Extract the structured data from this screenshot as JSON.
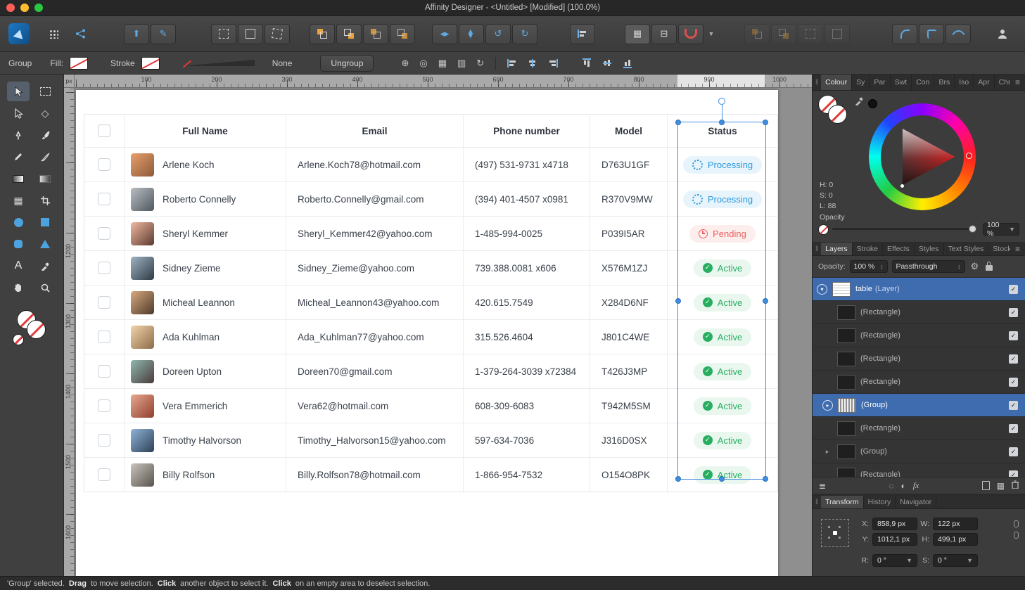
{
  "titlebar": {
    "title": "Affinity Designer - <Untitled> [Modified] (100.0%)"
  },
  "context_toolbar": {
    "selection_label": "Group",
    "fill_label": "Fill:",
    "stroke_label": "Stroke",
    "stroke_width_label": "None",
    "ungroup_button": "Ungroup"
  },
  "rulers": {
    "unit": "px",
    "horizontal_ticks": [
      100,
      200,
      300,
      400,
      500,
      600,
      700,
      800,
      900,
      1000
    ],
    "vertical_ticks": [
      1200,
      1300,
      1400,
      1500,
      1600
    ]
  },
  "document_table": {
    "columns": [
      "Full Name",
      "Email",
      "Phone number",
      "Model",
      "Status"
    ],
    "rows": [
      {
        "name": "Arlene Koch",
        "email": "Arlene.Koch78@hotmail.com",
        "phone": "(497) 531-9731 x4718",
        "model": "D763U1GF",
        "status": "Processing",
        "status_type": "processing",
        "avatar": [
          "#e9a06b",
          "#8a5a3b"
        ]
      },
      {
        "name": "Roberto Connelly",
        "email": "Roberto.Connelly@gmail.com",
        "phone": "(394) 401-4507 x0981",
        "model": "R370V9MW",
        "status": "Processing",
        "status_type": "processing",
        "avatar": [
          "#b9bec2",
          "#4f585f"
        ]
      },
      {
        "name": "Sheryl Kemmer",
        "email": "Sheryl_Kemmer42@yahoo.com",
        "phone": "1-485-994-0025",
        "model": "P039I5AR",
        "status": "Pending",
        "status_type": "pending",
        "avatar": [
          "#f2b8a0",
          "#5a3a30"
        ]
      },
      {
        "name": "Sidney Zieme",
        "email": "Sidney_Zieme@yahoo.com",
        "phone": "739.388.0081 x606",
        "model": "X576M1ZJ",
        "status": "Active",
        "status_type": "active",
        "avatar": [
          "#9fb4c4",
          "#2e3a44"
        ]
      },
      {
        "name": "Micheal Leannon",
        "email": "Micheal_Leannon43@yahoo.com",
        "phone": "420.615.7549",
        "model": "X284D6NF",
        "status": "Active",
        "status_type": "active",
        "avatar": [
          "#d9a97f",
          "#4e3a2a"
        ]
      },
      {
        "name": "Ada Kuhlman",
        "email": "Ada_Kuhlman77@yahoo.com",
        "phone": "315.526.4604",
        "model": "J801C4WE",
        "status": "Active",
        "status_type": "active",
        "avatar": [
          "#f0d4a8",
          "#8d6b4a"
        ]
      },
      {
        "name": "Doreen Upton",
        "email": "Doreen70@gmail.com",
        "phone": "1-379-264-3039 x72384",
        "model": "T426J3MP",
        "status": "Active",
        "status_type": "active",
        "avatar": [
          "#8fb8b0",
          "#4a3a3a"
        ]
      },
      {
        "name": "Vera Emmerich",
        "email": "Vera62@hotmail.com",
        "phone": "608-309-6083",
        "model": "T942M5SM",
        "status": "Active",
        "status_type": "active",
        "avatar": [
          "#e8a88e",
          "#8f3f2e"
        ]
      },
      {
        "name": "Timothy Halvorson",
        "email": "Timothy_Halvorson15@yahoo.com",
        "phone": "597-634-7036",
        "model": "J316D0SX",
        "status": "Active",
        "status_type": "active",
        "avatar": [
          "#8fb3d9",
          "#2e4055"
        ]
      },
      {
        "name": "Billy Rolfson",
        "email": "Billy.Rolfson78@hotmail.com",
        "phone": "1-866-954-7532",
        "model": "O154O8PK",
        "status": "Active",
        "status_type": "active",
        "avatar": [
          "#c9c4bd",
          "#57524b"
        ]
      }
    ],
    "status_colors": {
      "processing": {
        "fg": "#2e9bdb",
        "bg": "#e8f4fc"
      },
      "pending": {
        "fg": "#ec5f5f",
        "bg": "#fdeeee"
      },
      "active": {
        "fg": "#27ae60",
        "bg": "#e9f7ef"
      }
    }
  },
  "colour_panel": {
    "tabs": [
      "Colour",
      "Sy",
      "Par",
      "Swt",
      "Con",
      "Brs",
      "Iso",
      "Apr",
      "Chr"
    ],
    "active_tab": "Colour",
    "hsl": {
      "h_label": "H: 0",
      "s_label": "S: 0",
      "l_label": "L: 88"
    },
    "opacity_label": "Opacity",
    "opacity_value": "100 %"
  },
  "layers_panel": {
    "tabs": [
      "Layers",
      "Stroke",
      "Effects",
      "Styles",
      "Text Styles",
      "Stock"
    ],
    "active_tab": "Layers",
    "opacity_label": "Opacity:",
    "opacity_value": "100 %",
    "blend_mode": "Passthrough",
    "layers": [
      {
        "label": "table",
        "suffix": "(Layer)",
        "selected": true,
        "disclosure": "circle-down",
        "thumb": "table",
        "indent": 0,
        "checked": true
      },
      {
        "label": "(Rectangle)",
        "selected": false,
        "disclosure": "none",
        "thumb": "rect",
        "indent": 1,
        "checked": true
      },
      {
        "label": "(Rectangle)",
        "selected": false,
        "disclosure": "none",
        "thumb": "rect",
        "indent": 1,
        "checked": true
      },
      {
        "label": "(Rectangle)",
        "selected": false,
        "disclosure": "none",
        "thumb": "rect",
        "indent": 1,
        "checked": true
      },
      {
        "label": "(Rectangle)",
        "selected": false,
        "disclosure": "none",
        "thumb": "rect",
        "indent": 1,
        "checked": true
      },
      {
        "label": "(Group)",
        "selected": true,
        "disclosure": "circle-right",
        "thumb": "stripes",
        "indent": 1,
        "checked": true
      },
      {
        "label": "(Rectangle)",
        "selected": false,
        "disclosure": "none",
        "thumb": "rect",
        "indent": 1,
        "checked": true
      },
      {
        "label": "(Group)",
        "selected": false,
        "disclosure": "arrow-right",
        "thumb": "rect",
        "indent": 1,
        "checked": true
      },
      {
        "label": "(Rectangle)",
        "selected": false,
        "disclosure": "none",
        "thumb": "rect",
        "indent": 1,
        "checked": true
      }
    ]
  },
  "transform_panel": {
    "tabs": [
      "Transform",
      "History",
      "Navigator"
    ],
    "active_tab": "Transform",
    "fields": {
      "x_label": "X:",
      "x": "858,9 px",
      "y_label": "Y:",
      "y": "1012,1 px",
      "w_label": "W:",
      "w": "122 px",
      "h_label": "H:",
      "h": "499,1 px",
      "r_label": "R:",
      "r": "0 °",
      "s_label": "S:",
      "s": "0 °"
    }
  },
  "statusbar": {
    "segments": [
      {
        "text": "'Group' selected. ",
        "bold": false
      },
      {
        "text": "Drag",
        "bold": true
      },
      {
        "text": " to move selection. ",
        "bold": false
      },
      {
        "text": "Click",
        "bold": true
      },
      {
        "text": " another object to select it. ",
        "bold": false
      },
      {
        "text": "Click",
        "bold": true
      },
      {
        "text": " on an empty area to deselect selection.",
        "bold": false
      }
    ]
  },
  "icons": {
    "fx": "fx",
    "menu_glyph": "≡",
    "grip_glyph": "‖",
    "check_glyph": "✓"
  }
}
